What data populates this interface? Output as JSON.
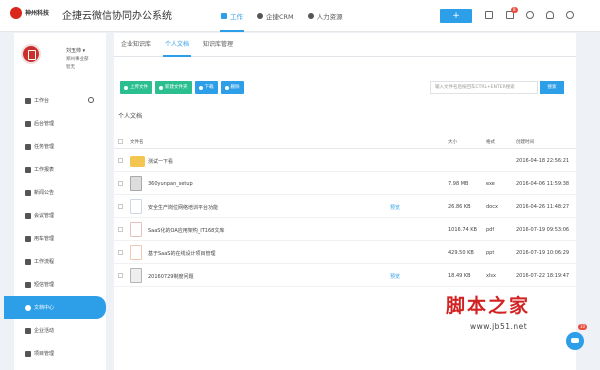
{
  "logo": {
    "brand": "神州科技"
  },
  "app": {
    "title": "企捷云微信协同办公系统"
  },
  "nav": {
    "items": [
      {
        "label": "工作",
        "icon": "briefcase-icon",
        "active": true
      },
      {
        "label": "企捷CRM",
        "icon": "globe-icon",
        "active": false
      },
      {
        "label": "人力资源",
        "icon": "people-icon",
        "active": false
      }
    ]
  },
  "topbar": {
    "plus_label": "+",
    "icons": [
      "grid-icon",
      "notification-icon",
      "gear-icon",
      "bulb-icon",
      "power-icon"
    ],
    "notification_badge": "8"
  },
  "profile": {
    "name": "刘玉帅 ▾",
    "dept": "郑州事业部",
    "role": "智无"
  },
  "sidebar": {
    "items": [
      {
        "label": "工作台",
        "icon": "home-icon"
      },
      {
        "label": "后台管理",
        "icon": "settings-icon"
      },
      {
        "label": "任务管理",
        "icon": "task-icon"
      },
      {
        "label": "工作报表",
        "icon": "report-icon"
      },
      {
        "label": "新闻公告",
        "icon": "news-icon"
      },
      {
        "label": "会议管理",
        "icon": "meeting-icon"
      },
      {
        "label": "用车管理",
        "icon": "car-icon"
      },
      {
        "label": "工作流程",
        "icon": "flow-icon"
      },
      {
        "label": "短信管理",
        "icon": "sms-icon"
      },
      {
        "label": "文档中心",
        "icon": "document-icon",
        "active": true
      },
      {
        "label": "企业活动",
        "icon": "flag-icon"
      },
      {
        "label": "项目管理",
        "icon": "project-icon"
      }
    ]
  },
  "tabs": [
    {
      "label": "企业知识库"
    },
    {
      "label": "个人文档",
      "active": true
    },
    {
      "label": "知识库管理"
    }
  ],
  "toolbar": {
    "upload": "上传文件",
    "new_folder": "新建文件夹",
    "download": "下载",
    "delete": "删除"
  },
  "search": {
    "placeholder": "输入文件名后按回车CTRL+ENTER搜索",
    "button": "搜索"
  },
  "section_title": "个人文档",
  "table": {
    "headers": {
      "name": "文件名",
      "size": "大小",
      "format": "格式",
      "created": "创建时间"
    },
    "rows": [
      {
        "name": "测试一下看",
        "type": "folder",
        "preview": "",
        "size": "",
        "format": "",
        "created": "2016-04-18 22:56:21"
      },
      {
        "name": "360yunpan_setup",
        "type": "exe",
        "preview": "",
        "size": "7.98 MB",
        "format": "exe",
        "created": "2016-04-06 11:59:38"
      },
      {
        "name": "安全生产岗位网络培训平台功能",
        "type": "doc",
        "preview": "预览",
        "size": "26.86 KB",
        "format": "docx",
        "created": "2016-04-26 11:48:27"
      },
      {
        "name": "SaaS化的OA应用架构_IT168文库",
        "type": "pdf",
        "preview": "",
        "size": "1016.74 KB",
        "format": "pdf",
        "created": "2016-07-19 09:53:06"
      },
      {
        "name": "基于SaaS的在线设计项目管理",
        "type": "ppt",
        "preview": "",
        "size": "429.50 KB",
        "format": "ppt",
        "created": "2016-07-19 10:06:29"
      },
      {
        "name": "20160729制度问题",
        "type": "zip",
        "preview": "预览",
        "size": "18.49 KB",
        "format": "xlsx",
        "created": "2016-07-22 18:19:47"
      }
    ]
  },
  "watermark": {
    "text": "脚本之家",
    "url": "www.jb51.net"
  },
  "chat": {
    "badge": "10"
  },
  "colors": {
    "accent": "#2d9ee8",
    "green": "#2bbf8f",
    "brand_red": "#d22222"
  }
}
